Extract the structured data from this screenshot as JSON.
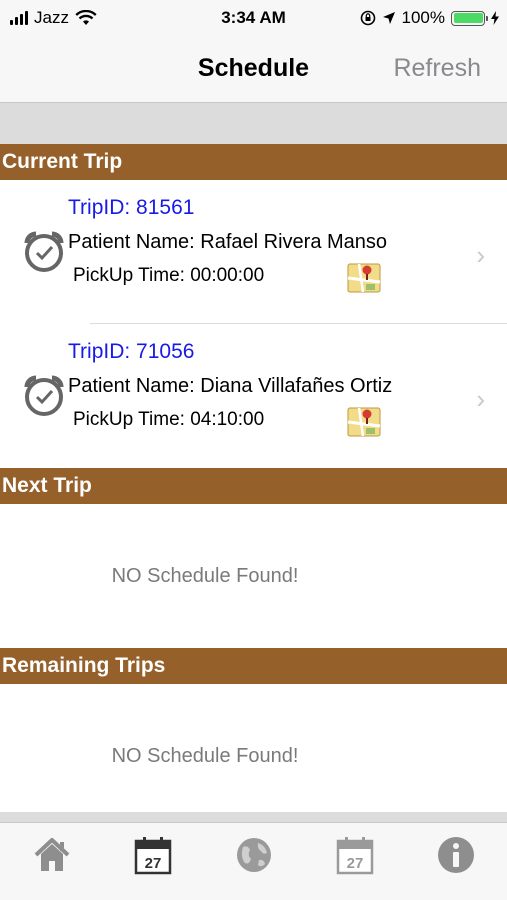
{
  "status_bar": {
    "carrier": "Jazz",
    "time": "3:34 AM",
    "battery": "100%",
    "icons": [
      "signal-icon",
      "wifi-icon",
      "orientation-lock-icon",
      "location-icon",
      "battery-icon",
      "charging-icon"
    ]
  },
  "navbar": {
    "title": "Schedule",
    "refresh_label": "Refresh"
  },
  "sections": {
    "current": "Current Trip",
    "next": "Next Trip",
    "remaining": "Remaining Trips"
  },
  "current_trips": [
    {
      "trip_id": "TripID: 81561",
      "patient": "Patient Name: Rafael Rivera Manso",
      "pickup": "PickUp Time: 00:00:00"
    },
    {
      "trip_id": "TripID: 71056",
      "patient": "Patient Name: Diana Villafañes Ortiz",
      "pickup": "PickUp Time: 04:10:00"
    }
  ],
  "next_trip": {
    "empty_text": "NO Schedule Found!"
  },
  "remaining_trips": {
    "empty_text": "NO Schedule Found!"
  },
  "tabbar": {
    "tabs": [
      "home-icon",
      "calendar-icon",
      "globe-icon",
      "calendar-icon",
      "info-icon"
    ],
    "calendar_day": "27",
    "selected_index": 1
  },
  "colors": {
    "section_header": "#96602b",
    "trip_id": "#1a1ae6",
    "battery_fill": "#4cd964"
  }
}
